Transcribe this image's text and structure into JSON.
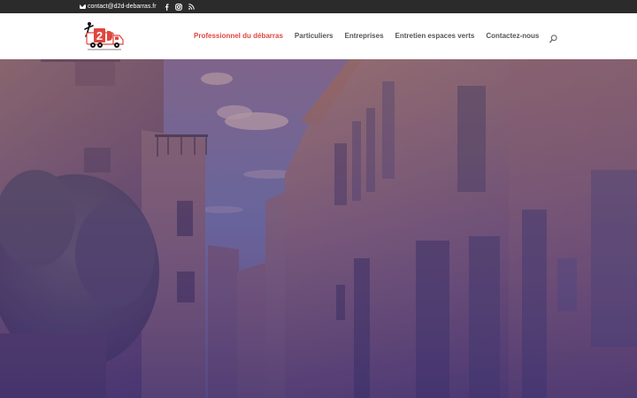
{
  "topbar": {
    "email": "contact@d2d-debarras.fr",
    "icons": [
      "mail-icon",
      "facebook-icon",
      "instagram-icon",
      "rss-icon"
    ]
  },
  "header": {
    "logo_text": "D2D",
    "nav": [
      {
        "label": "Professionnel du débarras",
        "active": true
      },
      {
        "label": "Particuliers",
        "active": false
      },
      {
        "label": "Entreprises",
        "active": false
      },
      {
        "label": "Entretien espaces verts",
        "active": false
      },
      {
        "label": "Contactez-nous",
        "active": false
      }
    ]
  },
  "colors": {
    "accent": "#e0463f",
    "topbar": "#2b2b2b",
    "nav_text": "#555555",
    "hero_overlay": "#5b3f86"
  }
}
